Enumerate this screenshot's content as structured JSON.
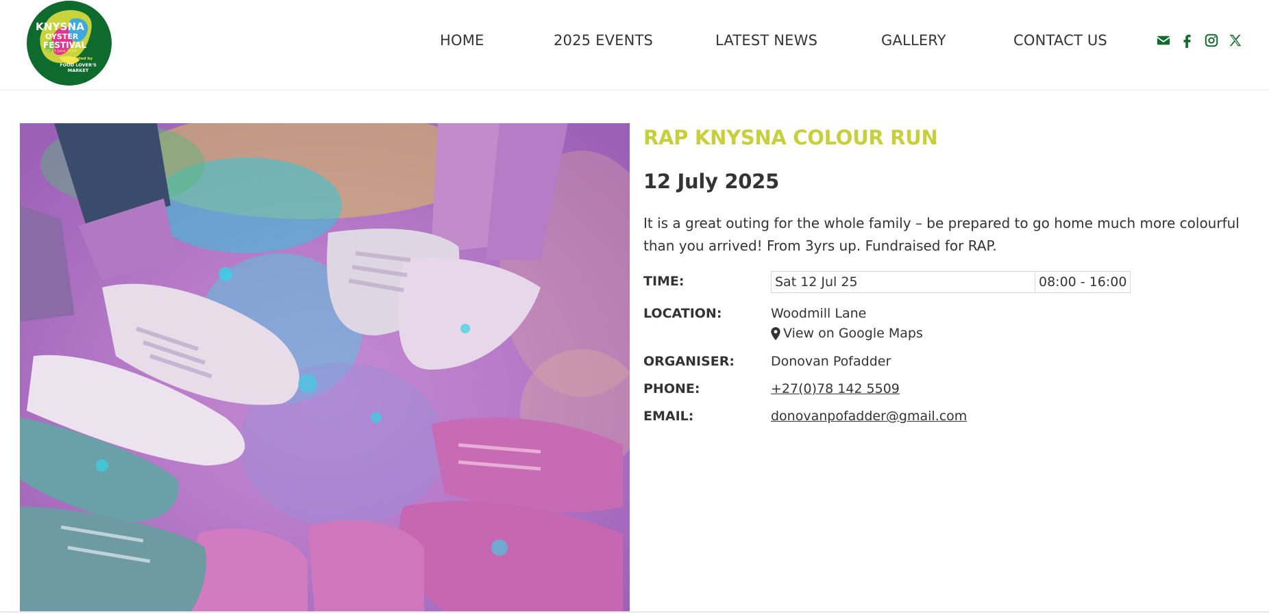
{
  "logo": {
    "line1": "KNYSNA",
    "line2": "OYSTER",
    "line3": "FESTIVAL",
    "line4": "26-30 June 2024",
    "line5": "presented by",
    "line6": "FOOD LOVER'S MARKET",
    "colors": {
      "circle": "#0e6b2d",
      "splash": "#c9d43c",
      "pink": "#e2378f",
      "blue": "#3fa9dd"
    }
  },
  "nav": {
    "items": [
      {
        "label": "HOME"
      },
      {
        "label": "2025 EVENTS"
      },
      {
        "label": "LATEST NEWS"
      },
      {
        "label": "GALLERY"
      },
      {
        "label": "CONTACT US"
      }
    ]
  },
  "social": {
    "icons": [
      "envelope-icon",
      "facebook-icon",
      "instagram-icon",
      "x-twitter-icon"
    ],
    "color": "#0e6b2d"
  },
  "photo": {
    "subject": "colour-powder-covered-sneakers"
  },
  "event": {
    "title": "RAP KNYSNA COLOUR RUN",
    "date": "12 July 2025",
    "description": "It is a great outing for the whole family – be prepared to go home much more colourful than you arrived! From 3yrs up. Fundraised for RAP.",
    "title_color": "#c8cf3c",
    "time_label": "TIME:",
    "time_day": "Sat 12 Jul 25",
    "time_hours": "08:00 - 16:00",
    "location_label": "LOCATION:",
    "location_value": "Woodmill Lane",
    "maps_link": "View on Google Maps",
    "organiser_label": "ORGANISER:",
    "organiser_value": "Donovan Pofadder",
    "phone_label": "PHONE:",
    "phone_value": "+27(0)78 142 5509",
    "email_label": "EMAIL:",
    "email_value": "donovanpofadder@gmail.com"
  }
}
